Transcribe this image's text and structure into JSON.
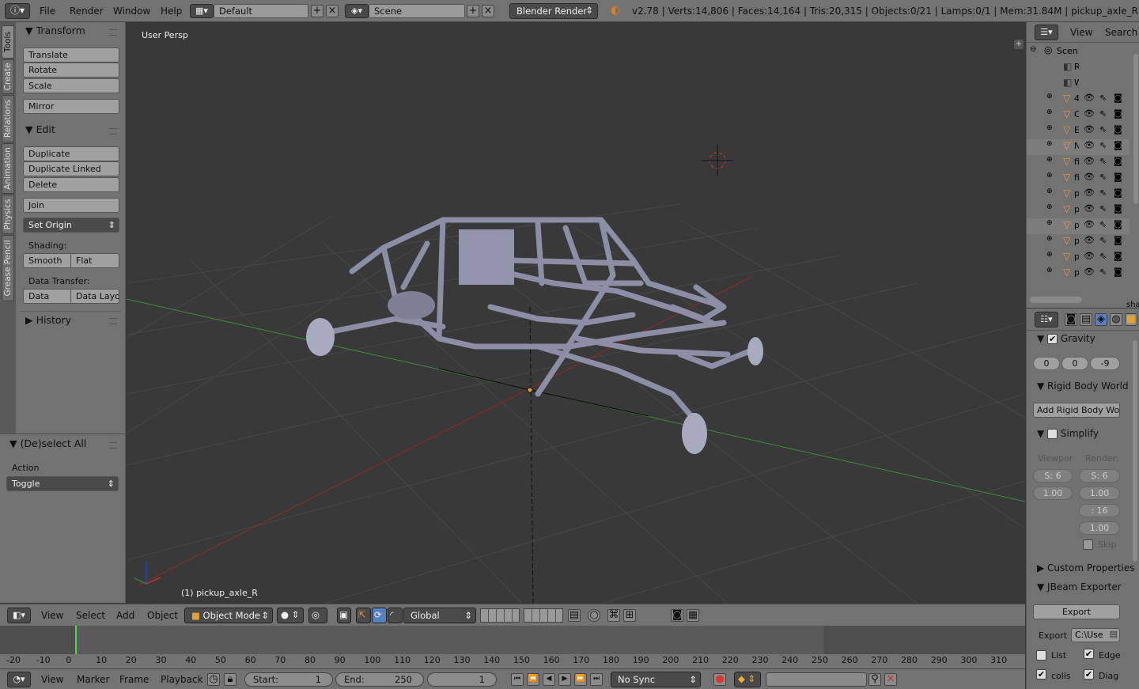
{
  "topbar": {
    "menus": [
      "File",
      "Render",
      "Window",
      "Help"
    ],
    "layout": "Default",
    "scene": "Scene",
    "engine": "Blender Render",
    "stats": "v2.78 | Verts:14,806 | Faces:14,164 | Tris:20,315 | Objects:0/21 | Lamps:0/1 | Mem:31.84M | pickup_axle_R"
  },
  "tabs": [
    "Tools",
    "Create",
    "Relations",
    "Animation",
    "Physics",
    "Grease Pencil"
  ],
  "tools": {
    "transform": "Transform",
    "translate": "Translate",
    "rotate": "Rotate",
    "scale": "Scale",
    "mirror": "Mirror",
    "edit": "Edit",
    "duplicate": "Duplicate",
    "duplicate_linked": "Duplicate Linked",
    "delete": "Delete",
    "join": "Join",
    "set_origin": "Set Origin",
    "shading": "Shading:",
    "smooth": "Smooth",
    "flat": "Flat",
    "data_transfer": "Data Transfer:",
    "data": "Data",
    "data_layo": "Data Layo",
    "history": "History"
  },
  "redo": {
    "title": "(De)select All",
    "action_label": "Action",
    "action_value": "Toggle"
  },
  "viewport": {
    "label": "User Persp",
    "selected": "(1) pickup_axle_R"
  },
  "view3d_header": {
    "menus": [
      "View",
      "Select",
      "Add",
      "Object"
    ],
    "mode": "Object Mode",
    "orientation": "Global"
  },
  "timeline": {
    "ticks": [
      "-20",
      "-10",
      "0",
      "10",
      "20",
      "30",
      "40",
      "50",
      "60",
      "70",
      "80",
      "90",
      "100",
      "110",
      "120",
      "130",
      "140",
      "150",
      "160",
      "170",
      "180",
      "190",
      "200",
      "210",
      "220",
      "230",
      "240",
      "250",
      "260",
      "270",
      "280",
      "290",
      "300",
      "310"
    ]
  },
  "timeline_header": {
    "menus": [
      "View",
      "Marker",
      "Frame",
      "Playback"
    ],
    "start_label": "Start:",
    "start": "1",
    "end_label": "End:",
    "end": "250",
    "current": "1",
    "sync": "No Sync"
  },
  "outliner": {
    "view": "View",
    "search": "Search",
    "scene": "Scen",
    "items": [
      "R",
      "W",
      "4",
      "C",
      "E",
      "N",
      "fi",
      "fi",
      "p",
      "p",
      "p",
      "p",
      "p",
      "p"
    ],
    "extra": "sha"
  },
  "props": {
    "gravity": "Gravity",
    "g": [
      "0",
      "0",
      "-9"
    ],
    "rbw": "Rigid Body World",
    "add_rbw": "Add Rigid Body Wo...",
    "simplify": "Simplify",
    "viewport": "Viewpor",
    "render": "Render:",
    "vp": [
      "S: 6",
      "1.00"
    ],
    "rd": [
      "S: 6",
      "1.00",
      ": 16",
      "1.00"
    ],
    "skip": "Skip",
    "custom": "Custom Properties",
    "jbeam": "JBeam Exporter",
    "export": "Export",
    "export_label": "Export",
    "path": "C:\\Use",
    "list": "List",
    "edge": "Edge",
    "colis": "colis",
    "diag": "Diag"
  }
}
